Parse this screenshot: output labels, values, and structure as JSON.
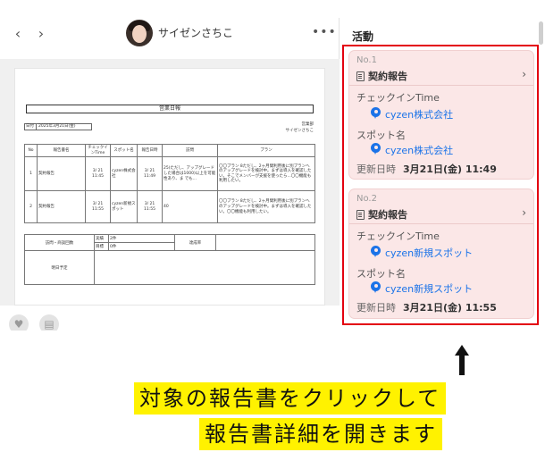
{
  "header": {
    "back_icon": "‹",
    "forward_icon": "›",
    "user_name": "サイゼンさちこ",
    "more_icon": "•••"
  },
  "report_document": {
    "title": "営業日報",
    "date_label": "日付",
    "date_value": "2025年3月21日(金)",
    "department": "営業部",
    "reporter": "サイゼンさちこ",
    "table_headers": [
      "No",
      "報告書名",
      "チェックインTime",
      "スポット名",
      "報告日時",
      "訪問",
      "プラン"
    ],
    "rows": [
      {
        "no": "1",
        "name": "契約報告",
        "checkin": "3/ 21 11:45",
        "spot": "cyzen株式会社",
        "reported": "3/ 21 11:49",
        "visit": "25(ただし、アップグレードした場合は1000)以上を可能性あり、ま\nでも...",
        "plan": "〇〇プラン 8ただし、2ヶ月間利用後に別プランへのアップグレードを検討中。まずは導入を確認したい。そこでメンバーが支援を使ったら...〇〇機能も利用したい。"
      },
      {
        "no": "2",
        "name": "契約報告",
        "checkin": "3/ 21 11:55",
        "spot": "cyzen新規スポット",
        "reported": "3/ 21 11:55",
        "visit": "40",
        "plan": "〇〇プラン 8ただし、2ヶ月間利用後に別プランへのアップグレードを検討中。まずは導入を確認したい。〇〇機能も利用したい。"
      }
    ],
    "summary": {
      "visit_count_label": "訪問・商談回数",
      "result_label": "実績",
      "result_value": "2件",
      "target_label": "目標",
      "target_value": "0件",
      "achievement_label": "達成率",
      "tomorrow_label": "明日予定"
    }
  },
  "footer": {
    "heart_icon": "♥",
    "note_icon": "▤"
  },
  "activity": {
    "title": "活動",
    "cards": [
      {
        "no": "No.1",
        "type": "契約報告",
        "checkin_label": "チェックインTime",
        "checkin_value": "cyzen株式会社",
        "spot_label": "スポット名",
        "spot_value": "cyzen株式会社",
        "updated_label": "更新日時",
        "updated_value": "3月21日(金) 11:49"
      },
      {
        "no": "No.2",
        "type": "契約報告",
        "checkin_label": "チェックインTime",
        "checkin_value": "cyzen新規スポット",
        "spot_label": "スポット名",
        "spot_value": "cyzen新規スポット",
        "updated_label": "更新日時",
        "updated_value": "3月21日(金) 11:55"
      }
    ]
  },
  "annotation": {
    "line1": "対象の報告書をクリックして",
    "line2": "報告書詳細を開きます",
    "highlight_color": "#e3000f",
    "caption_bg": "#fff200"
  }
}
